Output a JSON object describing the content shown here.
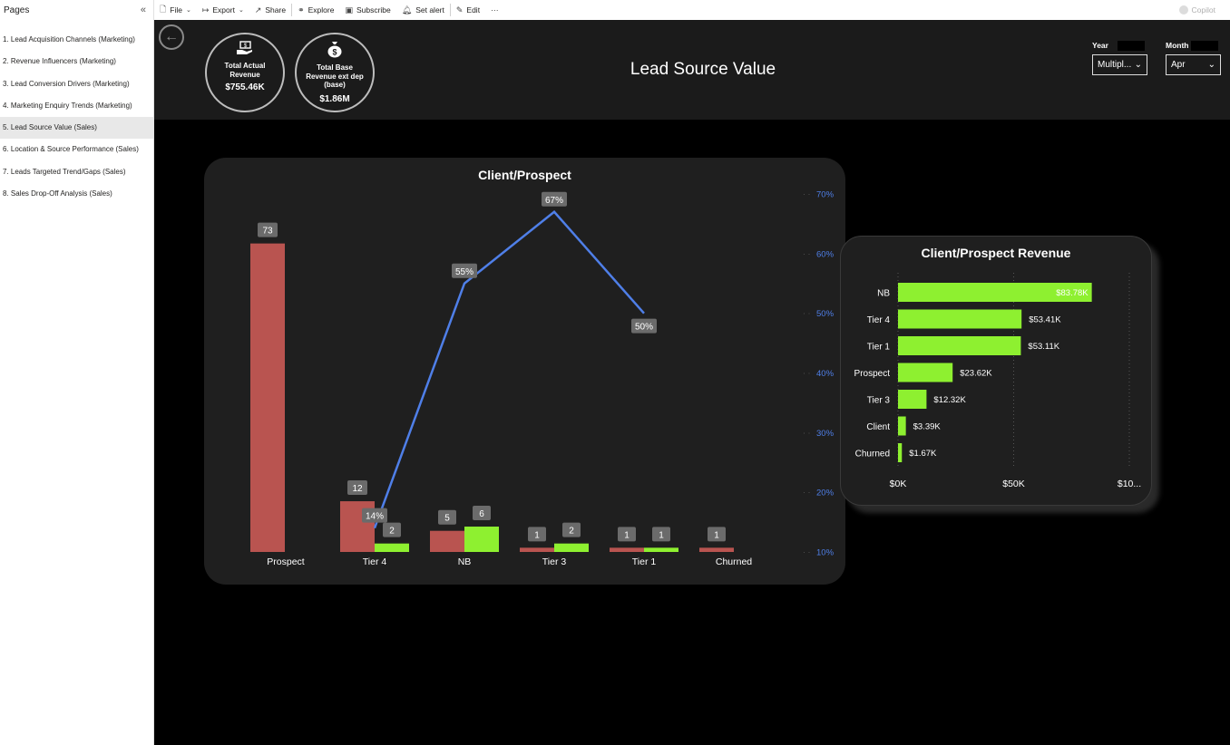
{
  "sidebar": {
    "title": "Pages",
    "collapse_icon": "«",
    "items": [
      {
        "label": "1. Lead Acquisition Channels (Marketing)"
      },
      {
        "label": "2. Revenue Influencers (Marketing)"
      },
      {
        "label": "3. Lead Conversion Drivers (Marketing)"
      },
      {
        "label": "4. Marketing Enquiry Trends (Marketing)"
      },
      {
        "label": "5. Lead Source Value (Sales)",
        "active": true
      },
      {
        "label": "6. Location & Source Performance (Sales)"
      },
      {
        "label": "7. Leads Targeted Trend/Gaps (Sales)"
      },
      {
        "label": "8. Sales Drop-Off Analysis (Sales)"
      }
    ]
  },
  "toolbar": {
    "file": "File",
    "export": "Export",
    "share": "Share",
    "explore": "Explore",
    "subscribe": "Subscribe",
    "set_alert": "Set alert",
    "edit": "Edit",
    "more": "···",
    "copilot": "Copilot"
  },
  "header": {
    "title": "Lead Source Value",
    "kpis": [
      {
        "label": "Total Actual Revenue",
        "value": "$755.46K",
        "icon": "money-hand-icon"
      },
      {
        "label": "Total Base Revenue ext dep (base)",
        "value": "$1.86M",
        "icon": "money-bag-icon"
      }
    ],
    "slicers": {
      "year": {
        "label": "Year",
        "value": "Multipl..."
      },
      "month": {
        "label": "Month",
        "value": "Apr"
      }
    }
  },
  "colors": {
    "red": "#b95450",
    "green": "#8ef030",
    "line": "#4f7fe8",
    "label_bg": "#6b6b6b"
  },
  "chart_data": [
    {
      "type": "bar+line",
      "title": "Client/Prospect",
      "categories": [
        "Prospect",
        "Tier 4",
        "NB",
        "Tier 3",
        "Tier 1",
        "Churned"
      ],
      "series": [
        {
          "values": [
            73,
            12,
            5,
            1,
            1,
            1
          ],
          "color": "#b95450"
        },
        {
          "values": [
            null,
            2,
            6,
            2,
            1,
            null
          ],
          "color": "#8ef030"
        }
      ],
      "line": {
        "values": [
          null,
          14,
          55,
          67,
          50,
          null
        ],
        "labels": [
          "",
          "14%",
          "55%",
          "67%",
          "50%",
          ""
        ],
        "color": "#4f7fe8"
      },
      "y2_ticks": [
        "70%",
        "60%",
        "50%",
        "40%",
        "30%",
        "20%",
        "10%"
      ],
      "y2lim": [
        10,
        70
      ]
    },
    {
      "type": "bar",
      "orientation": "horizontal",
      "title": "Client/Prospect Revenue",
      "categories": [
        "NB",
        "Tier 4",
        "Tier 1",
        "Prospect",
        "Tier 3",
        "Client",
        "Churned"
      ],
      "values": [
        83.78,
        53.41,
        53.11,
        23.62,
        12.32,
        3.39,
        1.67
      ],
      "value_labels": [
        "$83.78K",
        "$53.41K",
        "$53.11K",
        "$23.62K",
        "$12.32K",
        "$3.39K",
        "$1.67K"
      ],
      "x_ticks": [
        "$0K",
        "$50K",
        "$10..."
      ],
      "xlim": [
        0,
        100
      ],
      "color": "#8ef030"
    }
  ]
}
